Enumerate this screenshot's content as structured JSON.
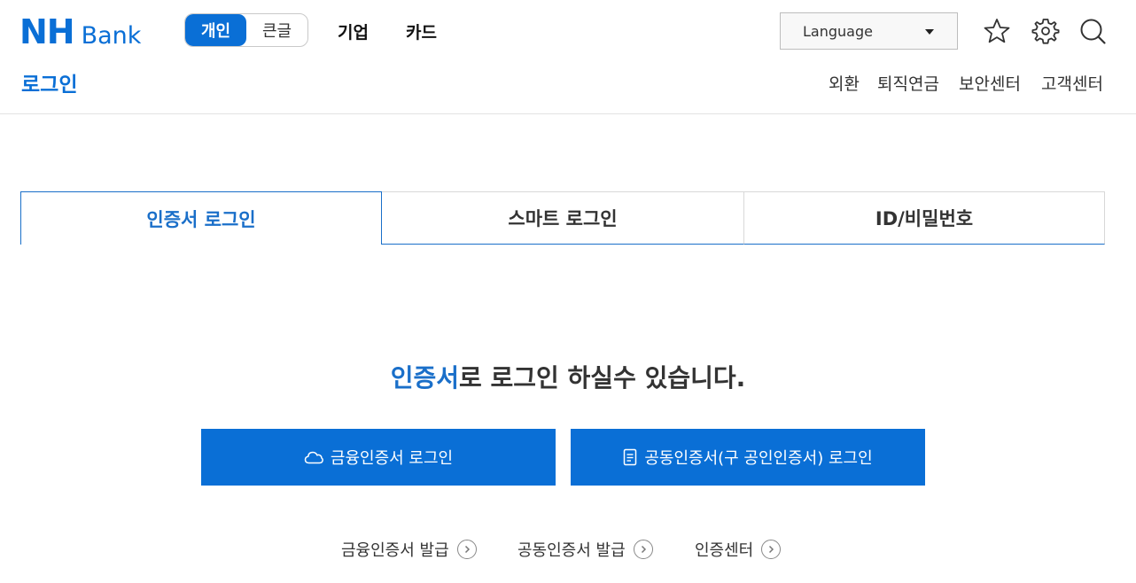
{
  "header": {
    "logo_nh": "NH",
    "logo_bank": "Bank",
    "segment": {
      "personal": "개인",
      "large_text": "큰글"
    },
    "nav": [
      "기업",
      "카드"
    ],
    "language": "Language",
    "page_title": "로그인",
    "subnav": [
      "외환",
      "퇴직연금",
      "보안센터",
      "고객센터"
    ],
    "icons": {
      "favorite": "star-icon",
      "settings": "gear-icon",
      "search": "search-icon"
    }
  },
  "tabs": [
    {
      "label": "인증서 로그인",
      "active": true
    },
    {
      "label": "스마트 로그인",
      "active": false
    },
    {
      "label": "ID/비밀번호",
      "active": false
    }
  ],
  "main": {
    "headline_highlight": "인증서",
    "headline_rest": "로 로그인 하실수 있습니다.",
    "buttons": {
      "financial_cert": "금융인증서 로그인",
      "joint_cert": "공동인증서(구 공인인증서) 로그인"
    },
    "links": [
      "금융인증서 발급",
      "공동인증서 발급",
      "인증센터"
    ]
  },
  "colors": {
    "brand": "#0a6fd6",
    "tab_accent": "#1a6fc9"
  }
}
